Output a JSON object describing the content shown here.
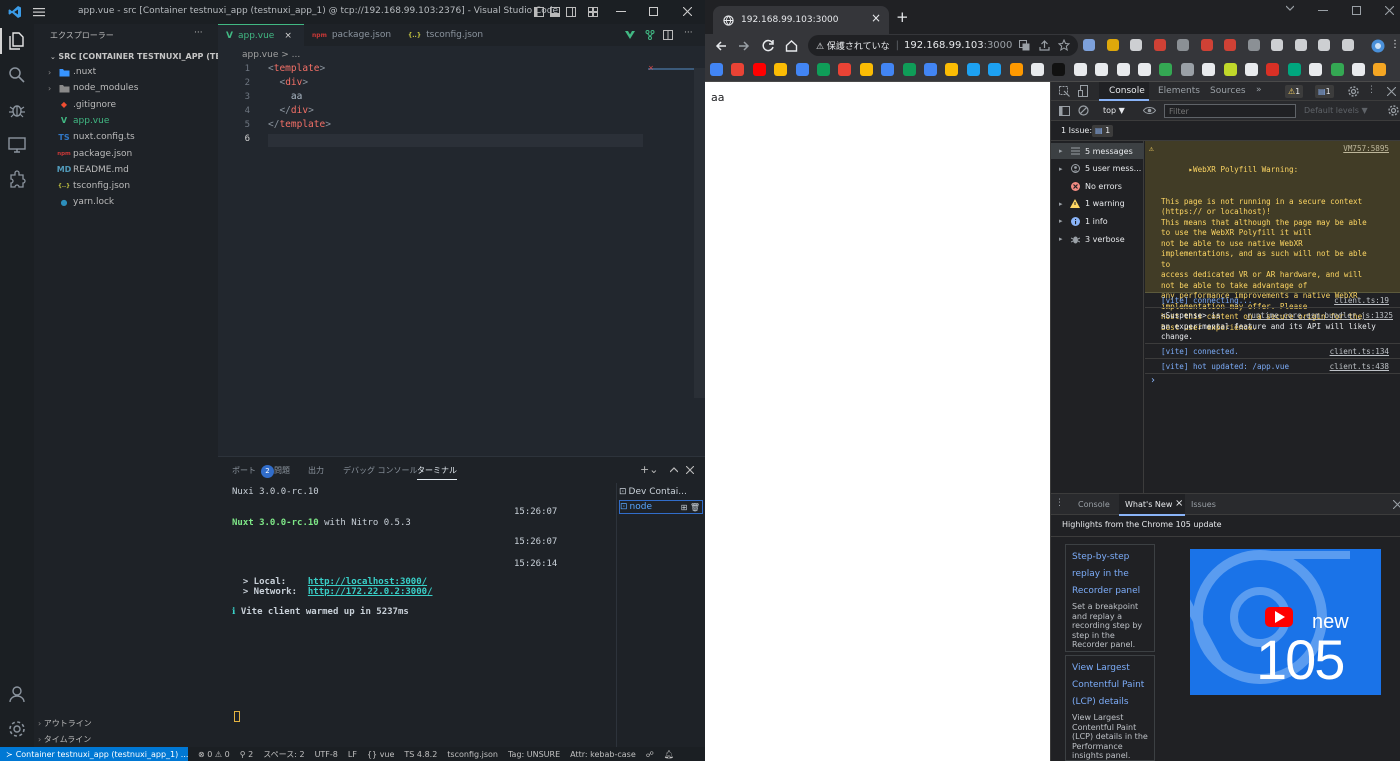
{
  "vscode": {
    "window_title": "app.vue - src [Container testnuxi_app (testnuxi_app_1) @ tcp://192.168.99.103:2376] - Visual Studio Code",
    "explorer_title": "エクスプローラー",
    "explorer_more": "···",
    "root": "SRC [CONTAINER TESTNUXI_APP (TESTN...",
    "files": [
      {
        "name": ".nuxt",
        "type": "folder",
        "color": "#3794ff"
      },
      {
        "name": "node_modules",
        "type": "folder",
        "color": "#8a8a8a"
      },
      {
        "name": ".gitignore",
        "type": "file",
        "icon": "◆",
        "color": "#f14e32"
      },
      {
        "name": "app.vue",
        "type": "file",
        "icon": "V",
        "color": "#41b883"
      },
      {
        "name": "nuxt.config.ts",
        "type": "file",
        "icon": "TS",
        "color": "#3178c6"
      },
      {
        "name": "package.json",
        "type": "file",
        "icon": "npm",
        "color": "#cb3837"
      },
      {
        "name": "README.md",
        "type": "file",
        "icon": "MD",
        "color": "#519aba"
      },
      {
        "name": "tsconfig.json",
        "type": "file",
        "icon": "{..}",
        "color": "#cbcb41"
      },
      {
        "name": "yarn.lock",
        "type": "file",
        "icon": "●",
        "color": "#2c8ebb"
      }
    ],
    "outline": "アウトライン",
    "timeline": "タイムライン",
    "tabs": [
      {
        "name": "app.vue",
        "icon": "V",
        "color": "#41b883",
        "active": true,
        "close": "×"
      },
      {
        "name": "package.json",
        "icon": "npm",
        "color": "#cb3837",
        "active": false
      },
      {
        "name": "tsconfig.json",
        "icon": "{..}",
        "color": "#cbcb41",
        "active": false
      }
    ],
    "breadcrumb": "app.vue > ...",
    "code_lines": [
      {
        "num": "1",
        "text": "<template>"
      },
      {
        "num": "2",
        "text": "  <div>"
      },
      {
        "num": "3",
        "text": "    aa"
      },
      {
        "num": "4",
        "text": "  </div>"
      },
      {
        "num": "5",
        "text": "</template>"
      },
      {
        "num": "6",
        "text": ""
      }
    ],
    "panel_tabs": [
      {
        "label": "ポート",
        "badge": "2"
      },
      {
        "label": "問題"
      },
      {
        "label": "出力"
      },
      {
        "label": "デバッグ コンソール"
      },
      {
        "label": "ターミナル",
        "active": true
      }
    ],
    "terminal_lines": [
      {
        "text": "Nuxi 3.0.0-rc.10"
      },
      {
        "time": "15:26:07"
      },
      {
        "text": "Nuxt 3.0.0-rc.10",
        "suffix": " with Nitro 0.5.3"
      },
      {
        "time": "15:26:07"
      },
      {
        "time": "15:26:14"
      },
      {
        "label": "  > Local:    ",
        "url": "http://localhost:3000/"
      },
      {
        "label": "  > Network:  ",
        "url": "http://172.22.0.2:3000/"
      },
      {
        "info": "ℹ",
        "text": " Vite client warmed up in 5237ms"
      }
    ],
    "terminal_list": [
      {
        "name": "Dev Contai..."
      },
      {
        "name": "node",
        "active": true
      }
    ],
    "status": {
      "remote": "Container testnuxi_app (testnuxi_app_1) ...",
      "errors": "⊗ 0 ⚠ 0",
      "ports": "2",
      "spaces": "スペース: 2",
      "encoding": "UTF-8",
      "eol": "LF",
      "language": "vue",
      "ts": "TS 4.8.2",
      "tsconfig": "tsconfig.json",
      "tag": "Tag: UNSURE",
      "attr": "Attr: kebab-case"
    }
  },
  "chrome": {
    "tab_title": "192.168.99.103:3000",
    "tab_close": "×",
    "new_tab": "+",
    "security": "⚠ 保護されていな",
    "url_host": "192.168.99.103",
    "url_port": ":3000",
    "page_text": "aa",
    "colors": {
      "bg": "#202124",
      "toolbar": "#35363a",
      "page": "#ffffff"
    }
  },
  "devtools": {
    "tabs": [
      "Console",
      "Elements",
      "Sources"
    ],
    "more_tabs": "»",
    "warn_count": "1",
    "msg_count": "1",
    "context": "top ▼",
    "filter_placeholder": "Filter",
    "levels": "Default levels ▼",
    "issues_label": "1 Issue:",
    "issues_count": "1",
    "sidebar": [
      {
        "label": "5 messages",
        "icon": "list",
        "chevron": true
      },
      {
        "label": "5 user mess...",
        "icon": "user",
        "chevron": true
      },
      {
        "label": "No errors",
        "icon": "error",
        "chevron": false
      },
      {
        "label": "1 warning",
        "icon": "warning",
        "chevron": true
      },
      {
        "label": "1 info",
        "icon": "info",
        "chevron": true
      },
      {
        "label": "3 verbose",
        "icon": "bug",
        "chevron": true
      }
    ],
    "warning_title": "▸WebXR Polyfill Warning:",
    "warning_src": "VM757:5895",
    "warning_body": "This page is not running in a secure context\n(https:// or localhost)!\nThis means that although the page may be able\nto use the WebXR Polyfill it will\nnot be able to use native WebXR\nimplementations, and as such will not be able\nto\naccess dedicated VR or AR hardware, and will\nnot be able to take advantage of\nany performance improvements a native WebXR\nimplementation may offer. Please\nhost this content on a secure origin for the\nbest user experience.",
    "messages": [
      {
        "text": "[vite] connecting...",
        "src": "client.ts:19",
        "vite": true
      },
      {
        "text": "<Suspense> is ",
        "src": "runtime-core.esm-bundler.js:1325",
        "rest": "an experimental feature and its API will likely\nchange.",
        "vite": false
      },
      {
        "text": "[vite] connected.",
        "src": "client.ts:134",
        "vite": true
      },
      {
        "text": "[vite] hot updated: /app.vue",
        "src": "client.ts:438",
        "vite": true
      }
    ],
    "prompt": "›",
    "drawer_tabs": [
      "Console",
      "What's New",
      "Issues"
    ],
    "drawer_close": "×",
    "whats_new_heading": "Highlights from the Chrome 105 update",
    "cards": [
      {
        "title": "Step-by-step replay in the Recorder panel",
        "body": "Set a breakpoint and replay a recording step by step in the Recorder panel."
      },
      {
        "title": "View Largest Contentful Paint (LCP) details",
        "body": "View Largest Contentful Paint (LCP) details in the Performance insights panel."
      }
    ],
    "promo_new": "new",
    "promo_version": "105"
  }
}
